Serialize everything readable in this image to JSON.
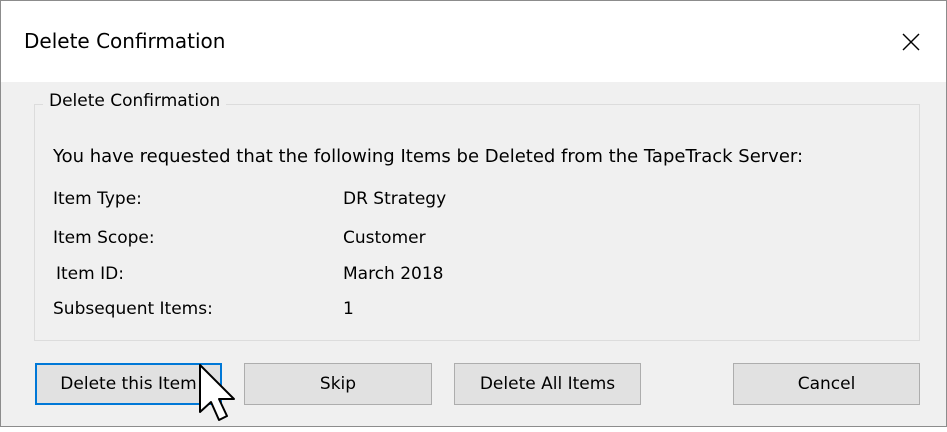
{
  "window": {
    "title": "Delete Confirmation"
  },
  "group": {
    "legend": "Delete Confirmation",
    "intro": "You have requested that the following Items be Deleted from the TapeTrack Server:",
    "rows": [
      {
        "label": "Item Type:",
        "value": "DR Strategy"
      },
      {
        "label": "Item Scope:",
        "value": "Customer"
      },
      {
        "label": "Item ID:",
        "value": "March 2018"
      },
      {
        "label": "Subsequent Items:",
        "value": "1"
      }
    ]
  },
  "buttons": {
    "delete_this": "Delete this Item",
    "skip": "Skip",
    "delete_all": "Delete All Items",
    "cancel": "Cancel"
  },
  "icons": {
    "close": "close-icon",
    "cursor": "mouse-cursor-icon"
  },
  "colors": {
    "focus_border": "#0078d7",
    "button_face": "#e1e1e1",
    "dialog_bg": "#f0f0f0"
  }
}
